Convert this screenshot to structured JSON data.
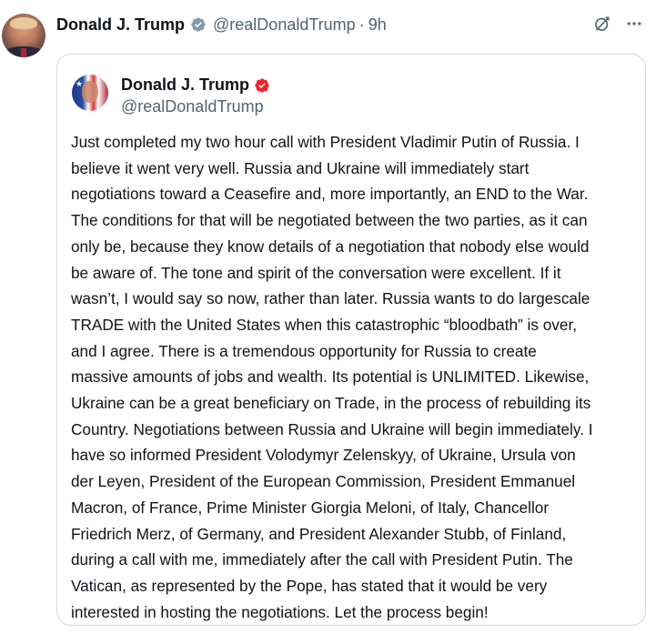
{
  "post": {
    "author_name": "Donald J. Trump",
    "author_handle": "@realDonaldTrump",
    "separator": "·",
    "time": "9h",
    "avatar_icon": "profile-photo",
    "verified_icon": "verified-badge-icon",
    "actions": {
      "grok_icon": "grok-icon",
      "more_icon": "more-options-icon"
    }
  },
  "quote": {
    "author_name": "Donald J. Trump",
    "author_handle": "@realDonaldTrump",
    "verified_icon": "red-verified-badge-icon",
    "text": "Just completed my two hour call with President Vladimir Putin of Russia. I\nbelieve it went very well. Russia and Ukraine will immediately start\nnegotiations toward a Ceasefire and, more importantly, an END to the War.\nThe conditions for that will be negotiated between the two parties, as it can\nonly be, because they know details of a negotiation that nobody else would\nbe aware of. The tone and spirit of the conversation were excellent. If it\nwasn’t, I would say so now, rather than later. Russia wants to do largescale\nTRADE with the United States when this catastrophic “bloodbath” is over,\nand I agree. There is a tremendous opportunity for Russia to create\nmassive amounts of jobs and wealth. Its potential is UNLIMITED. Likewise,\nUkraine can be a great beneficiary on Trade, in the process of rebuilding its\nCountry. Negotiations between Russia and Ukraine will begin immediately. I\nhave so informed President Volodymyr Zelenskyy, of Ukraine, Ursula von\nder Leyen, President of the European Commission, President Emmanuel\nMacron, of France, Prime Minister Giorgia Meloni, of Italy, Chancellor\nFriedrich Merz, of Germany, and President Alexander Stubb, of Finland,\nduring a call with me, immediately after the call with President Putin. The\nVatican, as represented by the Pope, has stated that it would be very\ninterested in hosting the negotiations. Let the process begin!"
  },
  "colors": {
    "text_primary": "#0f1419",
    "text_secondary": "#536471",
    "border": "#cfd9de",
    "verified_gray": "#829aab",
    "verified_red": "#f4212e"
  }
}
